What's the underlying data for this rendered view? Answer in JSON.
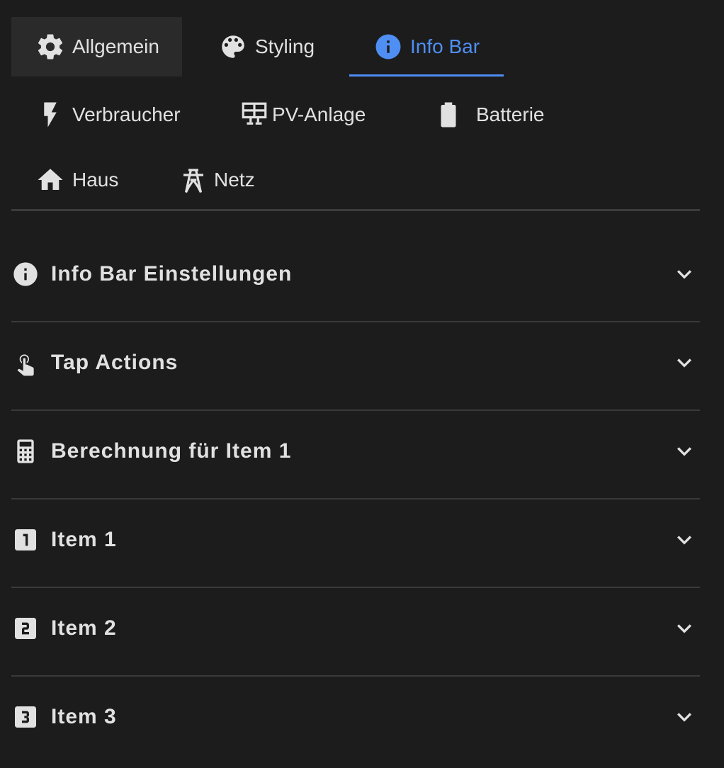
{
  "tabs": [
    {
      "label": "Allgemein",
      "icon": "gear-icon"
    },
    {
      "label": "Styling",
      "icon": "palette-icon"
    },
    {
      "label": "Info Bar",
      "icon": "info-icon",
      "active": true
    },
    {
      "label": "Verbraucher",
      "icon": "lightning-icon"
    },
    {
      "label": "PV-Anlage",
      "icon": "solar-panel-icon"
    },
    {
      "label": "Batterie",
      "icon": "battery-icon"
    },
    {
      "label": "Haus",
      "icon": "home-icon"
    },
    {
      "label": "Netz",
      "icon": "transmission-tower-icon"
    }
  ],
  "panels": [
    {
      "title": "Info Bar Einstellungen",
      "icon": "info-icon"
    },
    {
      "title": "Tap Actions",
      "icon": "gesture-tap-icon"
    },
    {
      "title": "Berechnung für Item 1",
      "icon": "calculator-icon"
    },
    {
      "title": "Item 1",
      "icon": "numeric-1-box-icon"
    },
    {
      "title": "Item 2",
      "icon": "numeric-2-box-icon"
    },
    {
      "title": "Item 3",
      "icon": "numeric-3-box-icon"
    }
  ],
  "colors": {
    "background": "#1c1c1c",
    "text": "#e1e1e1",
    "accent": "#4f8ef3",
    "divider": "#3a3a3a"
  }
}
